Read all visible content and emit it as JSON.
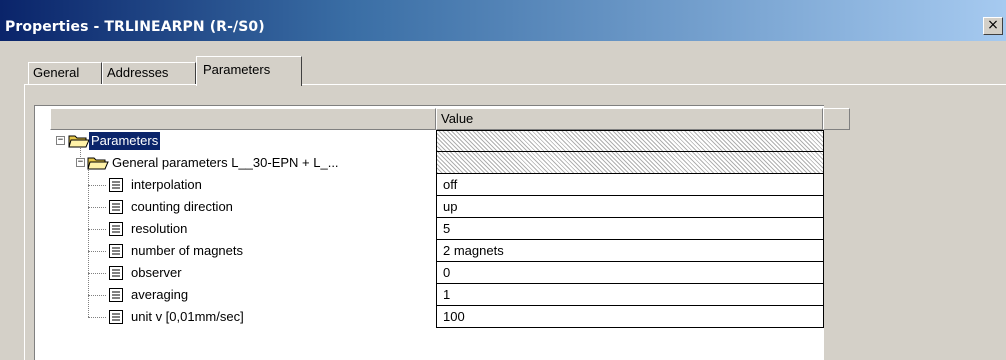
{
  "window": {
    "title": "Properties - TRLINEARPN (R-/S0)",
    "close_label": "×"
  },
  "tabs": [
    {
      "label": "General",
      "active": false
    },
    {
      "label": "Addresses",
      "active": false
    },
    {
      "label": "Parameters",
      "active": true
    }
  ],
  "grid": {
    "columns": {
      "name": "",
      "value": "Value"
    },
    "root": {
      "label": "Parameters",
      "expander": "−",
      "selected": true
    },
    "group": {
      "label": "General parameters L__30-EPN + L_...",
      "expander": "−"
    },
    "rows": [
      {
        "name": "interpolation",
        "value": "off"
      },
      {
        "name": "counting direction",
        "value": "up"
      },
      {
        "name": "resolution",
        "value": "5"
      },
      {
        "name": "number of magnets",
        "value": "2 magnets"
      },
      {
        "name": "observer",
        "value": "0"
      },
      {
        "name": "averaging",
        "value": "1"
      },
      {
        "name": "unit v [0,01mm/sec]",
        "value": "100"
      }
    ]
  },
  "colors": {
    "title_gradient_start": "#0a246a",
    "title_gradient_end": "#a6caf0",
    "dialog_bg": "#d4d0c8",
    "selection": "#0a246a"
  },
  "icons": {
    "folder": "folder-open-icon",
    "param": "parameter-doc-icon"
  }
}
